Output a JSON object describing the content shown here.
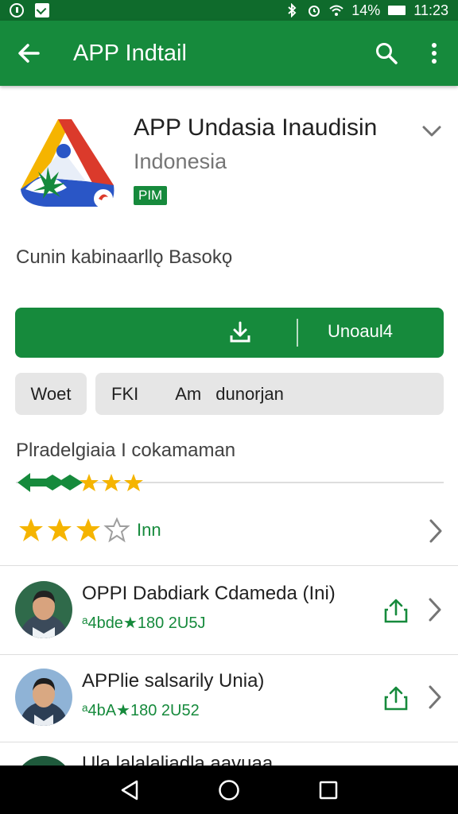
{
  "status_bar": {
    "battery": "14%",
    "time": "11:23",
    "icons": [
      "notification-icon",
      "mail-icon",
      "bluetooth-icon",
      "alarm-icon",
      "wifi-icon",
      "battery-icon"
    ]
  },
  "app_bar": {
    "title": "APP Indtail",
    "icons": [
      "back-arrow-icon",
      "search-icon",
      "more-vert-icon"
    ]
  },
  "app": {
    "name": "APP Undasia Inaudisin",
    "developer": "Indonesia",
    "badge": "PIM",
    "subtitle": "Cunin kabinaarllǫ Basokǫ"
  },
  "install": {
    "label": "Unoaul4",
    "icon": "download-icon"
  },
  "chips": {
    "chip_1": "Woet",
    "chip_2_a": "FKI",
    "chip_2_b": "Am",
    "chip_2_c": "dunorjan"
  },
  "ratings": {
    "title": "Plradelgiaia I cokamaman",
    "rating_value": 3,
    "rating_max": 4,
    "count_label": "Inn"
  },
  "reviews": [
    {
      "name": "OPPI Dabdiark  Cdameda (Ini)",
      "meta": "ᵃ4bde★180 2U5J"
    },
    {
      "name": "APPlie salsarily Unia)",
      "meta": "ᵃ4bA★180 2U52"
    }
  ],
  "partial_review": {
    "name": "Ula lalalaliadla aavuaa"
  },
  "colors": {
    "primary": "#168a3c",
    "primary_dark": "#0f6b2c",
    "star": "#f5b400",
    "text": "#212121",
    "muted": "#757575",
    "chip": "#e6e6e6"
  }
}
